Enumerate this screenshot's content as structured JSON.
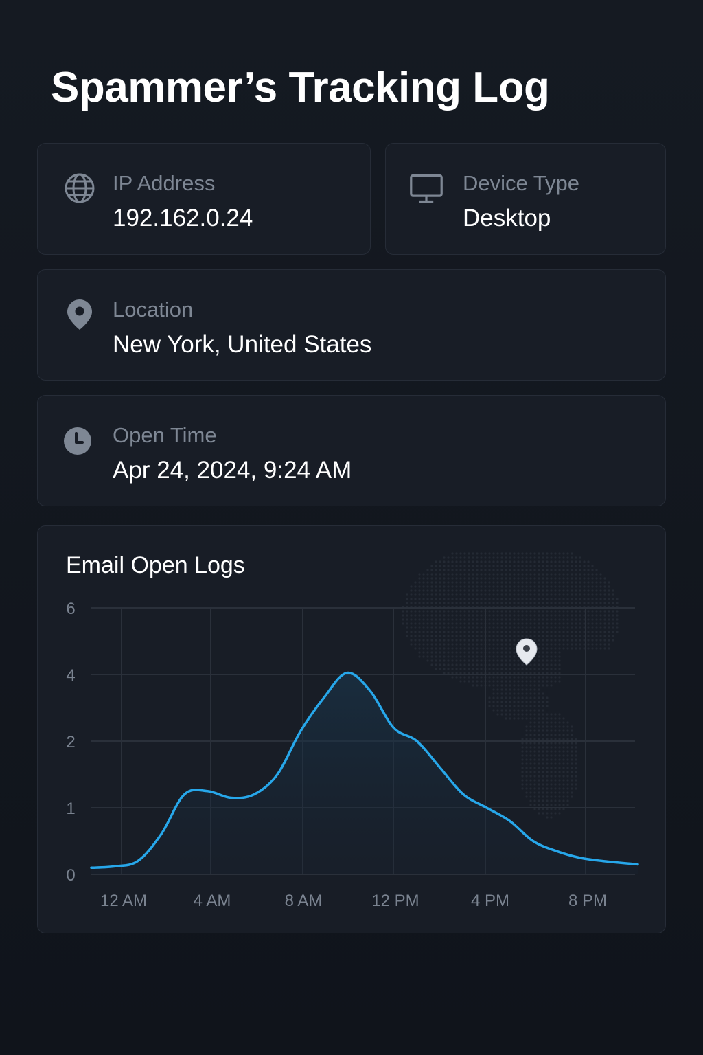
{
  "page": {
    "title": "Spammer’s Tracking Log"
  },
  "cards": {
    "ip": {
      "icon": "globe-icon",
      "label": "IP Address",
      "value": "192.162.0.24"
    },
    "device": {
      "icon": "monitor-icon",
      "label": "Device Type",
      "value": "Desktop"
    },
    "location": {
      "icon": "map-pin-icon",
      "label": "Location",
      "value": "New York, United States"
    },
    "time": {
      "icon": "clock-icon",
      "label": "Open Time",
      "value": "Apr 24, 2024, 9:24 AM"
    }
  },
  "colors": {
    "background": "#12161d",
    "card": "#181d26",
    "accent_line": "#27a7ea",
    "label": "#7e8794"
  },
  "chart_data": {
    "type": "line",
    "title": "Email Open Logs",
    "x_tick_labels": [
      "12 AM",
      "4 AM",
      "8 AM",
      "12 PM",
      "4 PM",
      "8 PM"
    ],
    "y_tick_labels": [
      "0",
      "1",
      "2",
      "4",
      "6"
    ],
    "y_scale": "categorical-ticks (0,1,2,4,6 evenly spaced)",
    "x_hours": [
      0,
      1,
      2,
      3,
      4,
      5,
      6,
      7,
      8,
      9,
      10,
      11,
      12,
      13,
      14,
      15,
      16,
      17,
      18,
      19,
      20,
      21,
      22,
      23.5
    ],
    "values": [
      0.1,
      0.12,
      0.2,
      0.6,
      1.2,
      1.25,
      1.15,
      1.2,
      1.5,
      2.3,
      3.3,
      4.05,
      3.5,
      2.4,
      2.0,
      1.6,
      1.2,
      1.0,
      0.8,
      0.5,
      0.35,
      0.25,
      0.2,
      0.15
    ],
    "grid": true,
    "legend": "none",
    "annotation": "map-pin-icon over dotted North America map"
  }
}
